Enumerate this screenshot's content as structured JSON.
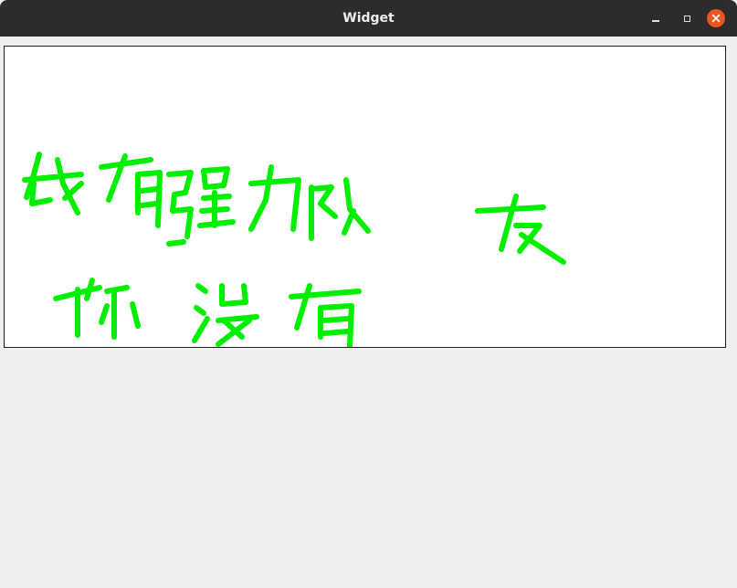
{
  "window": {
    "title": "Widget",
    "buttons": {
      "minimize": "minimize",
      "maximize": "maximize",
      "close": "close"
    }
  },
  "canvas": {
    "background": "#ffffff",
    "stroke_color": "#00ee00",
    "handwritten_text_lines": [
      "我有强力队友",
      "你没有"
    ]
  },
  "colors": {
    "titlebar": "#2c2c2c",
    "close_button": "#e95420",
    "window_background": "#efefef"
  }
}
